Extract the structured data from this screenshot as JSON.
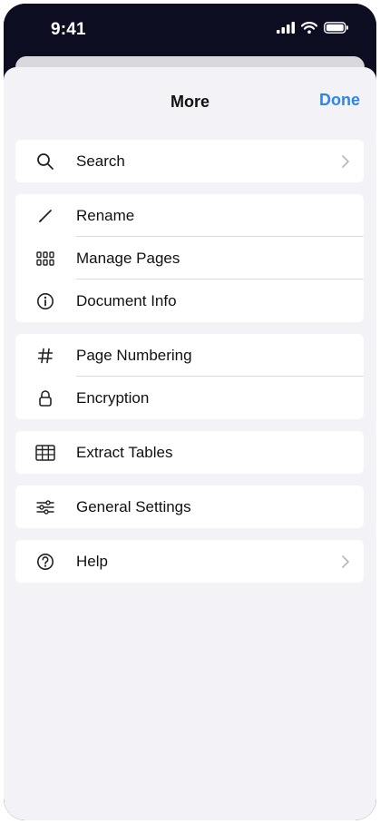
{
  "status_bar": {
    "time": "9:41"
  },
  "nav": {
    "title": "More",
    "done_label": "Done"
  },
  "groups": [
    {
      "items": [
        {
          "label": "Search",
          "icon": "search-icon",
          "chevron": true
        }
      ]
    },
    {
      "items": [
        {
          "label": "Rename",
          "icon": "pencil-icon"
        },
        {
          "label": "Manage Pages",
          "icon": "grid-icon"
        },
        {
          "label": "Document Info",
          "icon": "info-icon"
        }
      ]
    },
    {
      "items": [
        {
          "label": "Page Numbering",
          "icon": "hash-icon"
        },
        {
          "label": "Encryption",
          "icon": "lock-icon"
        }
      ]
    },
    {
      "items": [
        {
          "label": "Extract Tables",
          "icon": "table-icon"
        }
      ]
    },
    {
      "items": [
        {
          "label": "General Settings",
          "icon": "sliders-icon"
        }
      ]
    },
    {
      "items": [
        {
          "label": "Help",
          "icon": "help-icon",
          "chevron": true
        }
      ]
    }
  ],
  "colors": {
    "accent": "#2f86e6",
    "background": "#f2f2f7",
    "status_bar": "#0d0d22"
  }
}
